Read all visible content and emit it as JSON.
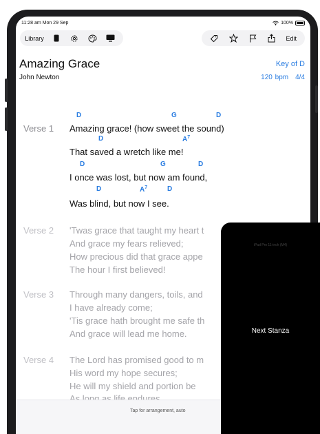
{
  "status": {
    "time": "11:28 am  Mon 29 Sep",
    "battery": "100%"
  },
  "toolbar": {
    "library_label": "Library",
    "left_icons": [
      "phone-icon",
      "gear-icon",
      "palette-icon",
      "monitor-icon"
    ],
    "right_icons": [
      "tag-icon",
      "star-icon",
      "flag-icon",
      "share-icon"
    ],
    "edit_label": "Edit"
  },
  "song": {
    "title": "Amazing Grace",
    "author": "John Newton",
    "key": "Key of D",
    "tempo": "120 bpm",
    "time_signature": "4/4"
  },
  "verses": [
    {
      "label": "Verse 1",
      "lines": [
        "Amazing grace! (how sweet the sound)",
        "That saved a wretch like me!",
        "I once was lost, but now am found,",
        "Was blind, but now I see."
      ],
      "chords": [
        [
          "D",
          "G",
          "D"
        ],
        [
          "D",
          "A",
          "7"
        ],
        [
          "D",
          "G",
          "D"
        ],
        [
          "D",
          "A",
          "7",
          "D"
        ]
      ]
    },
    {
      "label": "Verse 2",
      "lines": [
        "'Twas grace that taught my heart t",
        "And grace my fears relieved;",
        "How precious did that grace appe",
        "The hour I first believed!"
      ]
    },
    {
      "label": "Verse 3",
      "lines": [
        "Through many dangers, toils, and",
        "I have already come;",
        "'Tis grace hath brought me safe th",
        "And grace will lead me home."
      ]
    },
    {
      "label": "Verse 4",
      "lines": [
        "The Lord has promised good to m",
        "His word my hope secures;",
        "He will my shield and portion be",
        "As long as life endures."
      ]
    }
  ],
  "bottom_bar": {
    "hint": "Tap for arrangement, auto"
  },
  "overlay": {
    "device": "iPad Pro 11-inch (M4)",
    "action": "Next Stanza"
  },
  "colors": {
    "accent": "#2a7de1",
    "overlay": "#000000",
    "dim_text": "#a4a4a9"
  }
}
